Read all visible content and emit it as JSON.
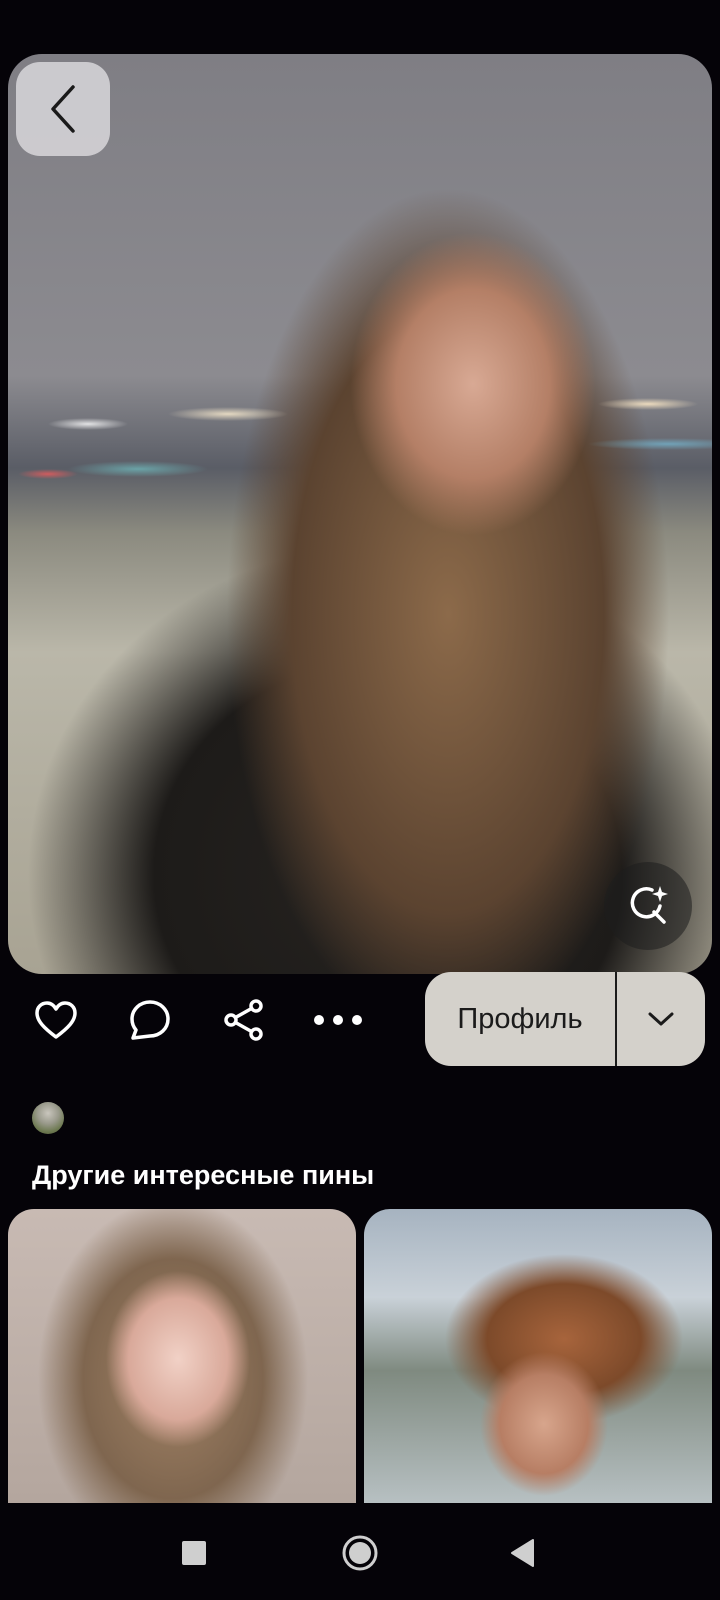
{
  "pin": {
    "image_alt": "Pin image"
  },
  "actions": {
    "profile_label": "Профиль"
  },
  "related": {
    "title": "Другие интересные пины"
  },
  "icons": {
    "back": "chevron-left-icon",
    "lens": "visual-search-icon",
    "like": "heart-icon",
    "comment": "comment-icon",
    "share": "share-icon",
    "more": "more-icon",
    "dropdown": "chevron-down-icon",
    "nav_recents": "square-icon",
    "nav_home": "circle-icon",
    "nav_back": "triangle-back-icon"
  },
  "colors": {
    "background": "#050308",
    "profile_button": "#d4d1cb",
    "icon": "#ffffff"
  }
}
